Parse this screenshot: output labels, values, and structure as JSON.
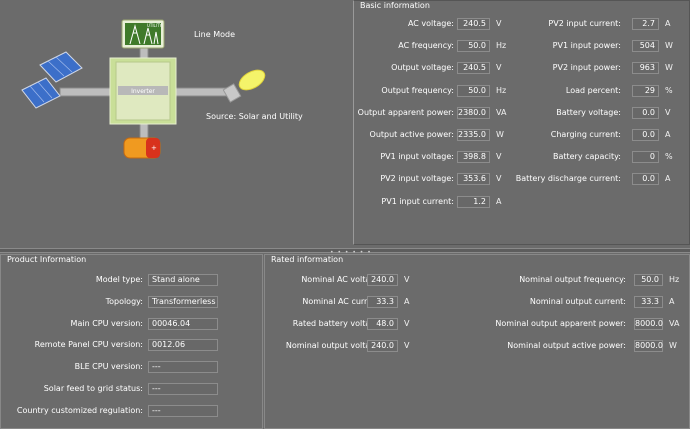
{
  "diagram": {
    "mode": "Line Mode",
    "source": "Source:  Solar and Utility",
    "inverter_label": "Inverter",
    "utility_label": "UTILITY"
  },
  "basic": {
    "title": "Basic information",
    "left": [
      {
        "label": "AC voltage:",
        "value": "240.5",
        "unit": "V"
      },
      {
        "label": "AC frequency:",
        "value": "50.0",
        "unit": "Hz"
      },
      {
        "label": "Output voltage:",
        "value": "240.5",
        "unit": "V"
      },
      {
        "label": "Output frequency:",
        "value": "50.0",
        "unit": "Hz"
      },
      {
        "label": "Output apparent power:",
        "value": "2380.0",
        "unit": "VA"
      },
      {
        "label": "Output active power:",
        "value": "2335.0",
        "unit": "W"
      },
      {
        "label": "PV1 input voltage:",
        "value": "398.8",
        "unit": "V"
      },
      {
        "label": "PV2 input voltage:",
        "value": "353.6",
        "unit": "V"
      },
      {
        "label": "PV1 input current:",
        "value": "1.2",
        "unit": "A"
      }
    ],
    "right": [
      {
        "label": "PV2 input current:",
        "value": "2.7",
        "unit": "A"
      },
      {
        "label": "PV1 input power:",
        "value": "504",
        "unit": "W"
      },
      {
        "label": "PV2 input power:",
        "value": "963",
        "unit": "W"
      },
      {
        "label": "Load percent:",
        "value": "29",
        "unit": "%"
      },
      {
        "label": "Battery voltage:",
        "value": "0.0",
        "unit": "V"
      },
      {
        "label": "Charging current:",
        "value": "0.0",
        "unit": "A"
      },
      {
        "label": "Battery capacity:",
        "value": "0",
        "unit": "%"
      },
      {
        "label": "Battery discharge current:",
        "value": "0.0",
        "unit": "A"
      }
    ]
  },
  "product": {
    "title": "Product Information",
    "rows": [
      {
        "label": "Model type:",
        "value": "Stand alone"
      },
      {
        "label": "Topology:",
        "value": "Transformerless"
      },
      {
        "label": "Main CPU version:",
        "value": "00046.04"
      },
      {
        "label": "Remote Panel CPU version:",
        "value": "0012.06"
      },
      {
        "label": "BLE CPU version:",
        "value": "---"
      },
      {
        "label": "Solar feed to grid status:",
        "value": "---"
      },
      {
        "label": "Country customized regulation:",
        "value": "---"
      }
    ]
  },
  "rated": {
    "title": "Rated information",
    "left": [
      {
        "label": "Nominal AC voltage:",
        "value": "240.0",
        "unit": "V"
      },
      {
        "label": "Nominal AC current:",
        "value": "33.3",
        "unit": "A"
      },
      {
        "label": "Rated battery voltage:",
        "value": "48.0",
        "unit": "V"
      },
      {
        "label": "Nominal output voltage:",
        "value": "240.0",
        "unit": "V"
      }
    ],
    "right": [
      {
        "label": "Nominal output frequency:",
        "value": "50.0",
        "unit": "Hz"
      },
      {
        "label": "Nominal output current:",
        "value": "33.3",
        "unit": "A"
      },
      {
        "label": "Nominal output apparent power:",
        "value": "8000.0",
        "unit": "VA"
      },
      {
        "label": "Nominal output active power:",
        "value": "8000.0",
        "unit": "W"
      }
    ]
  },
  "divider": {
    "grip": "• • • • • •"
  }
}
